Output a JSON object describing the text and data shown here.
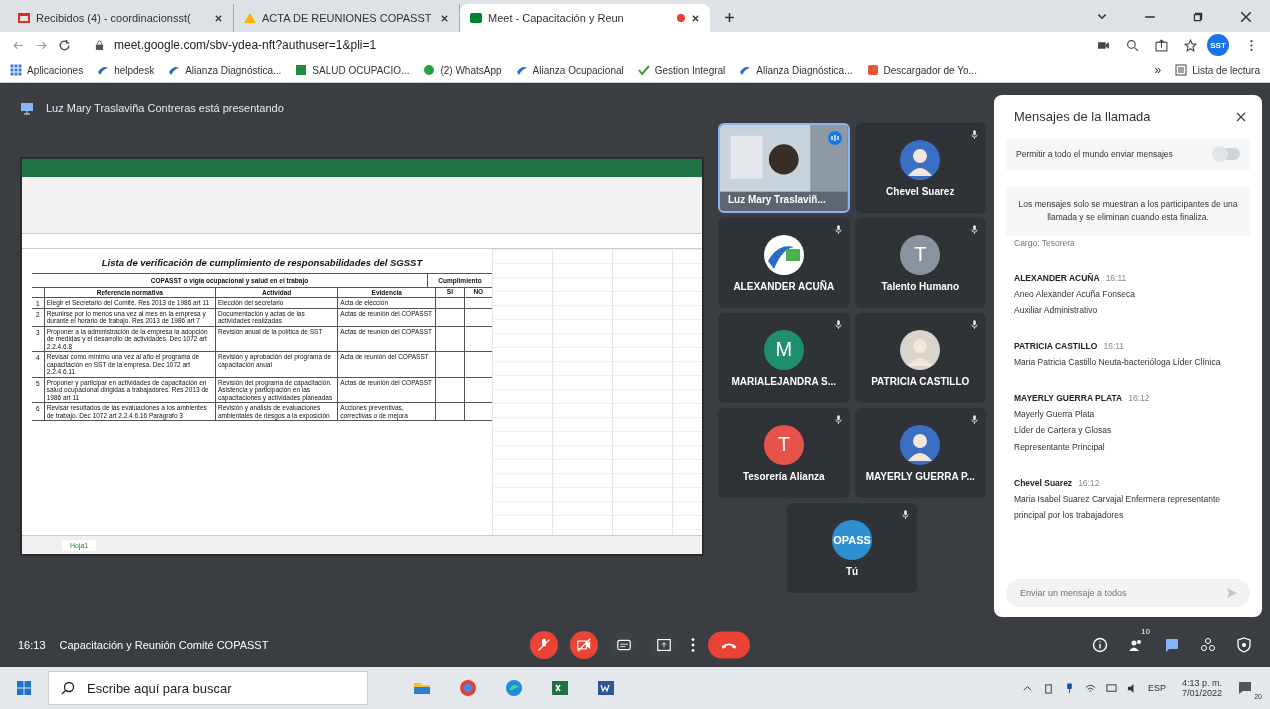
{
  "browser": {
    "tabs": [
      {
        "label": "Recibidos (4) - coordinacionsst(",
        "selected": false
      },
      {
        "label": "ACTA DE REUNIONES COPASST",
        "selected": false
      },
      {
        "label": "Meet - Capacitación y Reun",
        "selected": true
      }
    ],
    "url": "meet.google.com/sbv-ydea-nft?authuser=1&pli=1",
    "bookmarks": [
      "Aplicaciones",
      "helpdesk",
      "Alianza Diagnóstica...",
      "SALUD OCUPACIO...",
      "(2) WhatsApp",
      "Alianza Ocupacional",
      "Gestion Integral",
      "Alianza Diagnóstica...",
      "Descargador de Yo..."
    ],
    "more": "»",
    "reading_list": "Lista de lectura",
    "profile": "SST"
  },
  "meet": {
    "presenter": "Luz Mary Traslaviña Contreras está presentando",
    "sheet": {
      "title": "Lista de verificación de cumplimiento de responsabilidades del SGSST",
      "subtitle": "COPASST o vigía ocupacional y salud en el trabajo",
      "compliance": "Cumplimiento",
      "headers": [
        "Referencia normativa",
        "Actividad",
        "Evidencia",
        "SI",
        "NO"
      ],
      "rows": [
        {
          "num": "1",
          "reference": "Elegir el Secretario del Comité. Res 2013 de 1986 art 11",
          "activity": "Elección del secretario",
          "evidence": "Acta de elección"
        },
        {
          "num": "2",
          "reference": "Reunirse por lo menos una vez al mes en la empresa y durante el horario de trabajo. Res 2013 de 1986 art 7",
          "activity": "Documentación y actas de las actividades realizadas",
          "evidence": "Actas de reunión del COPASST"
        },
        {
          "num": "3",
          "reference": "Proponer a la administración de la empresa la adopción de medidas y el desarrollo de actividades. Dec 1072 art 2.2.4.6.8",
          "activity": "Revisión anual de la política de SST",
          "evidence": "Actas de reunión del COPASST"
        },
        {
          "num": "4",
          "reference": "Revisar como mínimo una vez al año el programa de capacitación en SST de la empresa. Dec 1072 art 2.2.4.6.11",
          "activity": "Revisión y aprobación del programa de capacitación anual",
          "evidence": "Acta de reunión del COPASST"
        },
        {
          "num": "5",
          "reference": "Proponer y participar en actividades de capacitación en salud ocupacional dirigidas a trabajadores. Res 2013 de 1986 art 11",
          "activity": "Revisión del programa de capacitación. Asistencia y participación en las capacitaciones y actividades planeadas",
          "evidence": "Actas de reunión del COPASST"
        },
        {
          "num": "6",
          "reference": "Revisar resultados de las evaluaciones a los ambientes de trabajo. Dec 1072 art 2.2.4.6.16 Parágrafo 3",
          "activity": "Revisión y análisis de evaluaciones ambientales de riesgos a la exposición",
          "evidence": "Acciones preventivas, correctivas o de mejora"
        }
      ],
      "sheet_tab": "Hoja1"
    },
    "tiles": [
      {
        "name": "Luz Mary Traslaviñ...",
        "kind": "video",
        "speaking": true
      },
      {
        "name": "Chevel Suarez",
        "speaking": false
      },
      {
        "name": "ALEXANDER ACUÑA",
        "kind": "logo",
        "speaking": false
      },
      {
        "name": "Talento Humano",
        "kind": "letter",
        "letter": "T",
        "color": "#8a939e",
        "speaking": false
      },
      {
        "name": "MARIALEJANDRA S...",
        "kind": "letter",
        "letter": "M",
        "color": "#1e8e6e",
        "speaking": false
      },
      {
        "name": "PATRICIA CASTILLO",
        "speaking": false
      },
      {
        "name": "Tesorería Alianza",
        "kind": "letter",
        "letter": "T",
        "color": "#e5534b",
        "speaking": false
      },
      {
        "name": "MAYERLY GUERRA P...",
        "speaking": false
      },
      {
        "name": "Tú",
        "kind": "letter",
        "letter": "OPASS",
        "color": "#2f8fd0",
        "speaking": false
      }
    ],
    "chat": {
      "title": "Mensajes de la llamada",
      "permit": "Permitir a todo el mundo enviar mensajes",
      "permit_on": false,
      "notice": "Los mensajes solo se muestran a los participantes de una llamada y se eliminan cuando esta finaliza.",
      "cut_line": "Cargo: Tesorera",
      "messages": [
        {
          "sender": "ALEXANDER ACUÑA",
          "time": "16:11",
          "lines": [
            "Aneo Alexander Acuña Fonseca",
            "Auxiliar Administrativo"
          ]
        },
        {
          "sender": "PATRICIA CASTILLO",
          "time": "16:11",
          "lines": [
            "Maria Patricia Castillo Neuta-bacterióloga Líder Clínica"
          ]
        },
        {
          "sender": "MAYERLY GUERRA PLATA",
          "time": "16:12",
          "lines": [
            "Mayerly Guerra Plata",
            "Líder de Cartera y Glosas",
            "Representante Principal"
          ]
        },
        {
          "sender": "Chevel Suarez",
          "time": "16:12",
          "lines": [
            "Maria Isabel Suarez Carvajal Enfermera representante principal por los trabajadores"
          ]
        }
      ],
      "input_placeholder": "Enviar un mensaje a todos"
    },
    "clock": "16:13",
    "meeting_title": "Capacitación y Reunión Comité COPASST",
    "participants_count": "10"
  },
  "taskbar": {
    "search_placeholder": "Escribe aquí para buscar",
    "lang": "ESP",
    "time": "4:13 p. m.",
    "date": "7/01/2022",
    "notif": "20"
  }
}
